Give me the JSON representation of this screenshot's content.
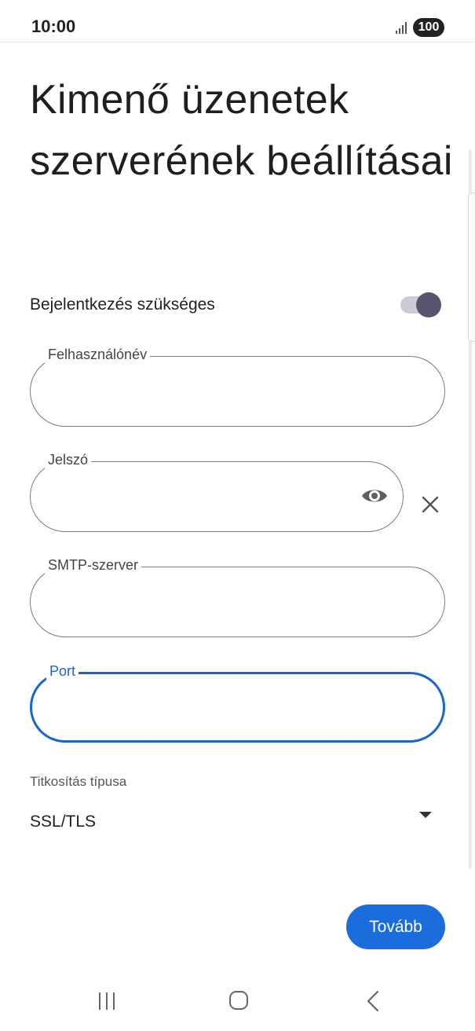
{
  "status_bar": {
    "time": "10:00",
    "battery": "100"
  },
  "page": {
    "title": "Kimenő üzenetek szerverének beállításai"
  },
  "login_required": {
    "label": "Bejelentkezés szükséges",
    "enabled": true
  },
  "fields": {
    "username": {
      "label": "Felhasználónév",
      "value": ""
    },
    "password": {
      "label": "Jelszó",
      "value": ""
    },
    "smtp_server": {
      "label": "SMTP-szerver",
      "value": ""
    },
    "port": {
      "label": "Port",
      "value": ""
    }
  },
  "encryption": {
    "label": "Titkosítás típusa",
    "selected": "SSL/TLS"
  },
  "actions": {
    "next_label": "Tovább"
  },
  "icons": {
    "signal": "signal-icon",
    "eye": "eye-icon",
    "clear": "close-icon",
    "dropdown": "chevron-down-icon",
    "nav_recent": "recent-apps-icon",
    "nav_home": "home-icon",
    "nav_back": "back-icon"
  },
  "colors": {
    "accent": "#1a66c7",
    "button": "#1a6ddb",
    "toggle_thumb": "#5a5370",
    "toggle_track": "#cfcbd6"
  }
}
